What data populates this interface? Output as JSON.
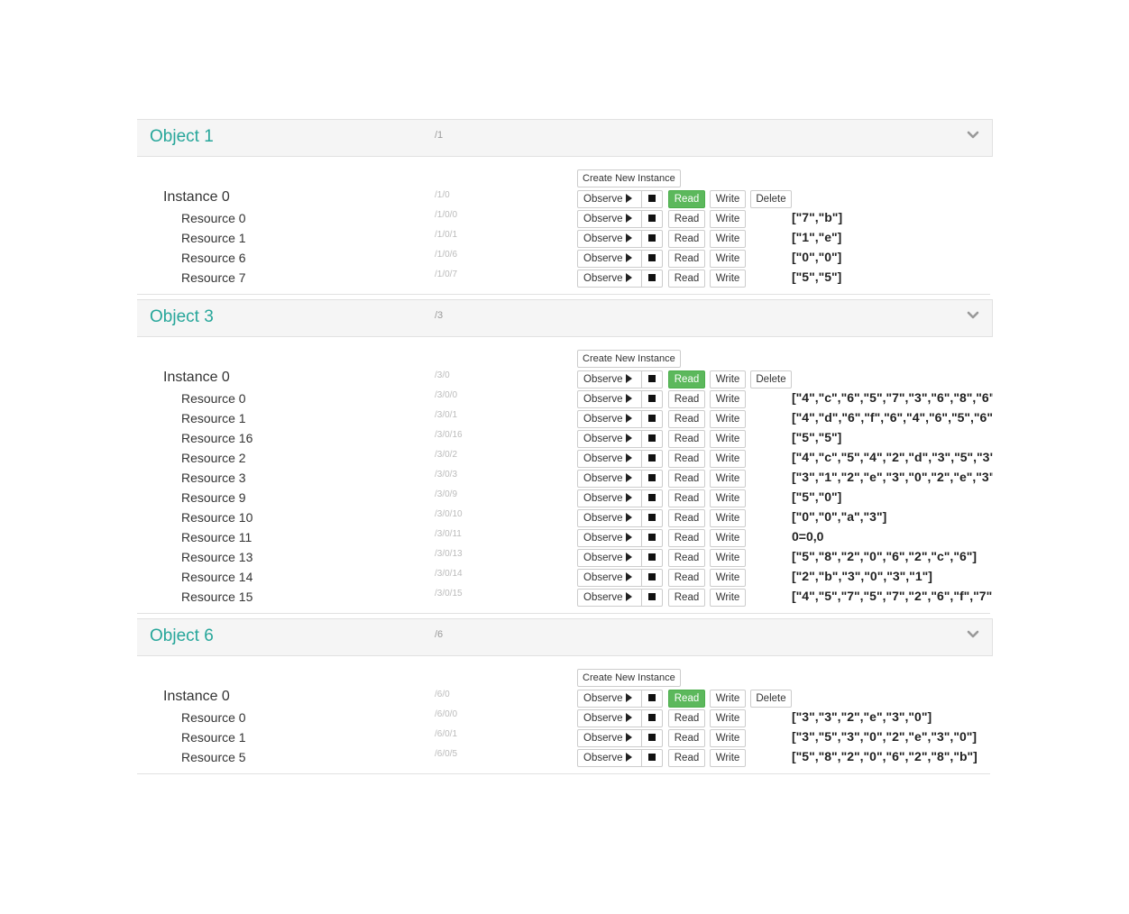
{
  "buttons": {
    "create_instance": "Create New Instance",
    "observe": "Observe",
    "read": "Read",
    "write": "Write",
    "delete": "Delete"
  },
  "objects": [
    {
      "title": "Object 1",
      "path": "/1",
      "instances": [
        {
          "name": "Instance 0",
          "path": "/1/0",
          "resources": [
            {
              "name": "Resource 0",
              "path": "/1/0/0",
              "value": "[\"7\",\"b\"]"
            },
            {
              "name": "Resource 1",
              "path": "/1/0/1",
              "value": "[\"1\",\"e\"]"
            },
            {
              "name": "Resource 6",
              "path": "/1/0/6",
              "value": "[\"0\",\"0\"]"
            },
            {
              "name": "Resource 7",
              "path": "/1/0/7",
              "value": "[\"5\",\"5\"]"
            }
          ]
        }
      ]
    },
    {
      "title": "Object 3",
      "path": "/3",
      "instances": [
        {
          "name": "Instance 0",
          "path": "/3/0",
          "resources": [
            {
              "name": "Resource 0",
              "path": "/3/0/0",
              "value": "[\"4\",\"c\",\"6\",\"5\",\"7\",\"3\",\"6\",\"8\",\"6\""
            },
            {
              "name": "Resource 1",
              "path": "/3/0/1",
              "value": "[\"4\",\"d\",\"6\",\"f\",\"6\",\"4\",\"6\",\"5\",\"6\""
            },
            {
              "name": "Resource 16",
              "path": "/3/0/16",
              "value": "[\"5\",\"5\"]"
            },
            {
              "name": "Resource 2",
              "path": "/3/0/2",
              "value": "[\"4\",\"c\",\"5\",\"4\",\"2\",\"d\",\"3\",\"5\",\"3\""
            },
            {
              "name": "Resource 3",
              "path": "/3/0/3",
              "value": "[\"3\",\"1\",\"2\",\"e\",\"3\",\"0\",\"2\",\"e\",\"3\""
            },
            {
              "name": "Resource 9",
              "path": "/3/0/9",
              "value": "[\"5\",\"0\"]"
            },
            {
              "name": "Resource 10",
              "path": "/3/0/10",
              "value": "[\"0\",\"0\",\"a\",\"3\"]"
            },
            {
              "name": "Resource 11",
              "path": "/3/0/11",
              "value": "0=0,0"
            },
            {
              "name": "Resource 13",
              "path": "/3/0/13",
              "value": "[\"5\",\"8\",\"2\",\"0\",\"6\",\"2\",\"c\",\"6\"]"
            },
            {
              "name": "Resource 14",
              "path": "/3/0/14",
              "value": "[\"2\",\"b\",\"3\",\"0\",\"3\",\"1\"]"
            },
            {
              "name": "Resource 15",
              "path": "/3/0/15",
              "value": "[\"4\",\"5\",\"7\",\"5\",\"7\",\"2\",\"6\",\"f\",\"7\""
            }
          ]
        }
      ]
    },
    {
      "title": "Object 6",
      "path": "/6",
      "instances": [
        {
          "name": "Instance 0",
          "path": "/6/0",
          "resources": [
            {
              "name": "Resource 0",
              "path": "/6/0/0",
              "value": "[\"3\",\"3\",\"2\",\"e\",\"3\",\"0\"]"
            },
            {
              "name": "Resource 1",
              "path": "/6/0/1",
              "value": "[\"3\",\"5\",\"3\",\"0\",\"2\",\"e\",\"3\",\"0\"]"
            },
            {
              "name": "Resource 5",
              "path": "/6/0/5",
              "value": "[\"5\",\"8\",\"2\",\"0\",\"6\",\"2\",\"8\",\"b\"]"
            }
          ]
        }
      ]
    }
  ]
}
